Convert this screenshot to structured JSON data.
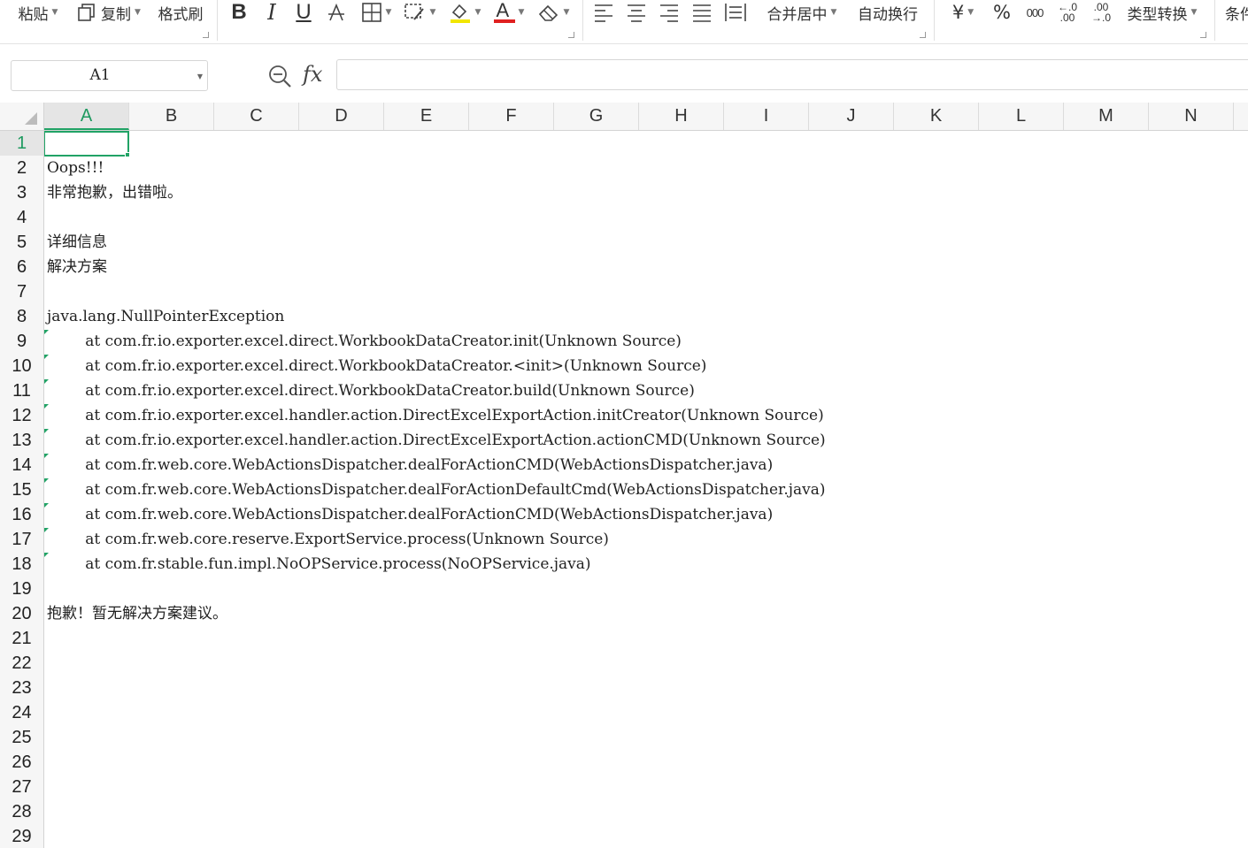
{
  "colors": {
    "accent": "#21a366",
    "font_color_bar": "#e02020",
    "fill_color_bar": "#f2e600"
  },
  "ribbon": {
    "paste_label": "粘贴",
    "copy_label": "复制",
    "format_painter_label": "格式刷",
    "bold_label": "B",
    "italic_label": "I",
    "underline_label": "U",
    "font_color_label": "A",
    "merge_center_label": "合并居中",
    "wrap_text_label": "自动换行",
    "currency_label": "¥",
    "percent_label": "%",
    "thousands_label": "000",
    "increase_decimal_label": "←.0\n.00",
    "decrease_decimal_label": ".00\n→.0",
    "type_convert_label": "类型转换",
    "conditional_label": "条件"
  },
  "formula_bar": {
    "name_box": "A1",
    "fx_label": "fx",
    "formula_value": ""
  },
  "columns": [
    "A",
    "B",
    "C",
    "D",
    "E",
    "F",
    "G",
    "H",
    "I",
    "J",
    "K",
    "L",
    "M",
    "N"
  ],
  "rows": [
    "1",
    "2",
    "3",
    "4",
    "5",
    "6",
    "7",
    "8",
    "9",
    "10",
    "11",
    "12",
    "13",
    "14",
    "15",
    "16",
    "17",
    "18",
    "19",
    "20",
    "21",
    "22",
    "23",
    "24",
    "25",
    "26",
    "27",
    "28",
    "29"
  ],
  "cells": {
    "A2": "Oops!!!",
    "A3": "非常抱歉，出错啦。",
    "A5": "详细信息",
    "A6": "解决方案",
    "A8": "java.lang.NullPointerException",
    "A9": "        at com.fr.io.exporter.excel.direct.WorkbookDataCreator.init(Unknown Source)",
    "A10": "        at com.fr.io.exporter.excel.direct.WorkbookDataCreator.<init>(Unknown Source)",
    "A11": "        at com.fr.io.exporter.excel.direct.WorkbookDataCreator.build(Unknown Source)",
    "A12": "        at com.fr.io.exporter.excel.handler.action.DirectExcelExportAction.initCreator(Unknown Source)",
    "A13": "        at com.fr.io.exporter.excel.handler.action.DirectExcelExportAction.actionCMD(Unknown Source)",
    "A14": "        at com.fr.web.core.WebActionsDispatcher.dealForActionCMD(WebActionsDispatcher.java)",
    "A15": "        at com.fr.web.core.WebActionsDispatcher.dealForActionDefaultCmd(WebActionsDispatcher.java)",
    "A16": "        at com.fr.web.core.WebActionsDispatcher.dealForActionCMD(WebActionsDispatcher.java)",
    "A17": "        at com.fr.web.core.reserve.ExportService.process(Unknown Source)",
    "A18": "        at com.fr.stable.fun.impl.NoOPService.process(NoOPService.java)",
    "A20": "抱歉！暂无解决方案建议。"
  }
}
